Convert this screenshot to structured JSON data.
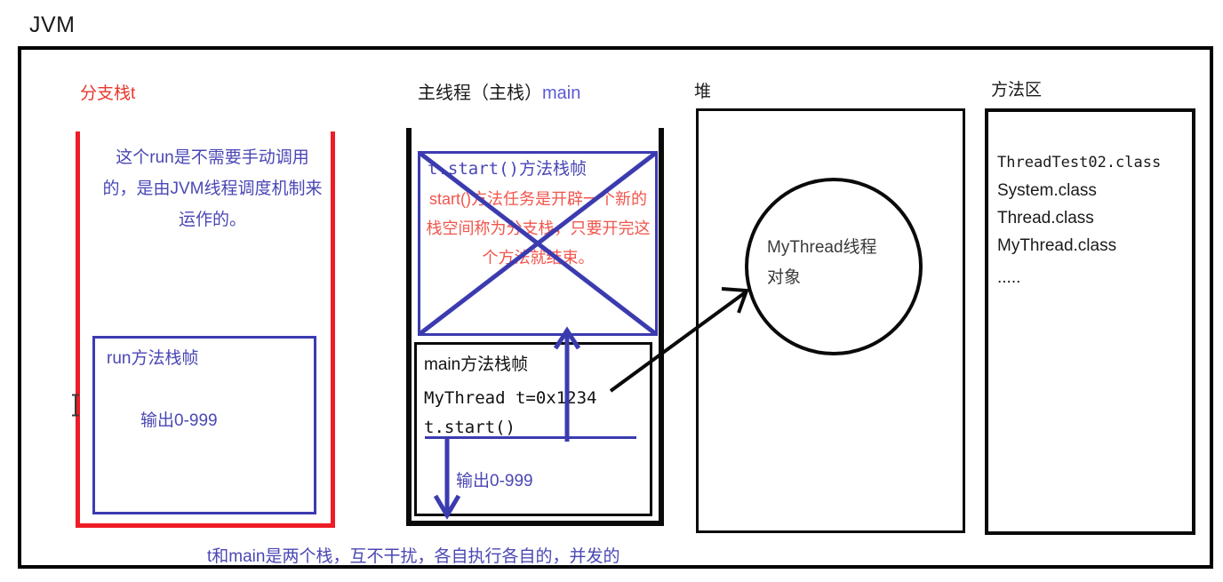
{
  "title": "JVM",
  "columns": {
    "branch_stack": "分支栈t",
    "main_thread_prefix": "主线程（主栈）",
    "main_thread_name": "main",
    "heap": "堆",
    "method_area": "方法区"
  },
  "branch": {
    "note": "这个run是不需要手动调用的，是由JVM线程调度机制来运作的。",
    "run_frame_label": "run方法栈帧",
    "run_frame_output": "输出0-999",
    "stack_color": "#ee1c25",
    "frame_color": "#3b3bb0",
    "text_color": "#4a47b5"
  },
  "main": {
    "tstart_frame_label": "t.start()方法栈帧",
    "tstart_note": "start()方法任务是开辟一个新的栈空间称为分支栈，只要开完这个方法就结束。",
    "tstart_note_color": "#f1554c",
    "struck_through": true,
    "main_frame_label": "main方法栈帧",
    "code_lines": [
      "MyThread t=0x1234",
      "t.start()"
    ],
    "output_label": "输出0-999",
    "stack_color": "#0a0a0a"
  },
  "heap": {
    "object_line1": "MyThread线程",
    "object_line2": "对象"
  },
  "method_area": {
    "classes": [
      "ThreadTest02.class",
      "System.class",
      "Thread.class",
      "MyThread.class",
      "....."
    ]
  },
  "caption": "t和main是两个栈，互不干扰，各自执行各自的，并发的",
  "colors": {
    "red": "#ee1c25",
    "blue": "#4a47b5",
    "black": "#0a0a0a"
  }
}
